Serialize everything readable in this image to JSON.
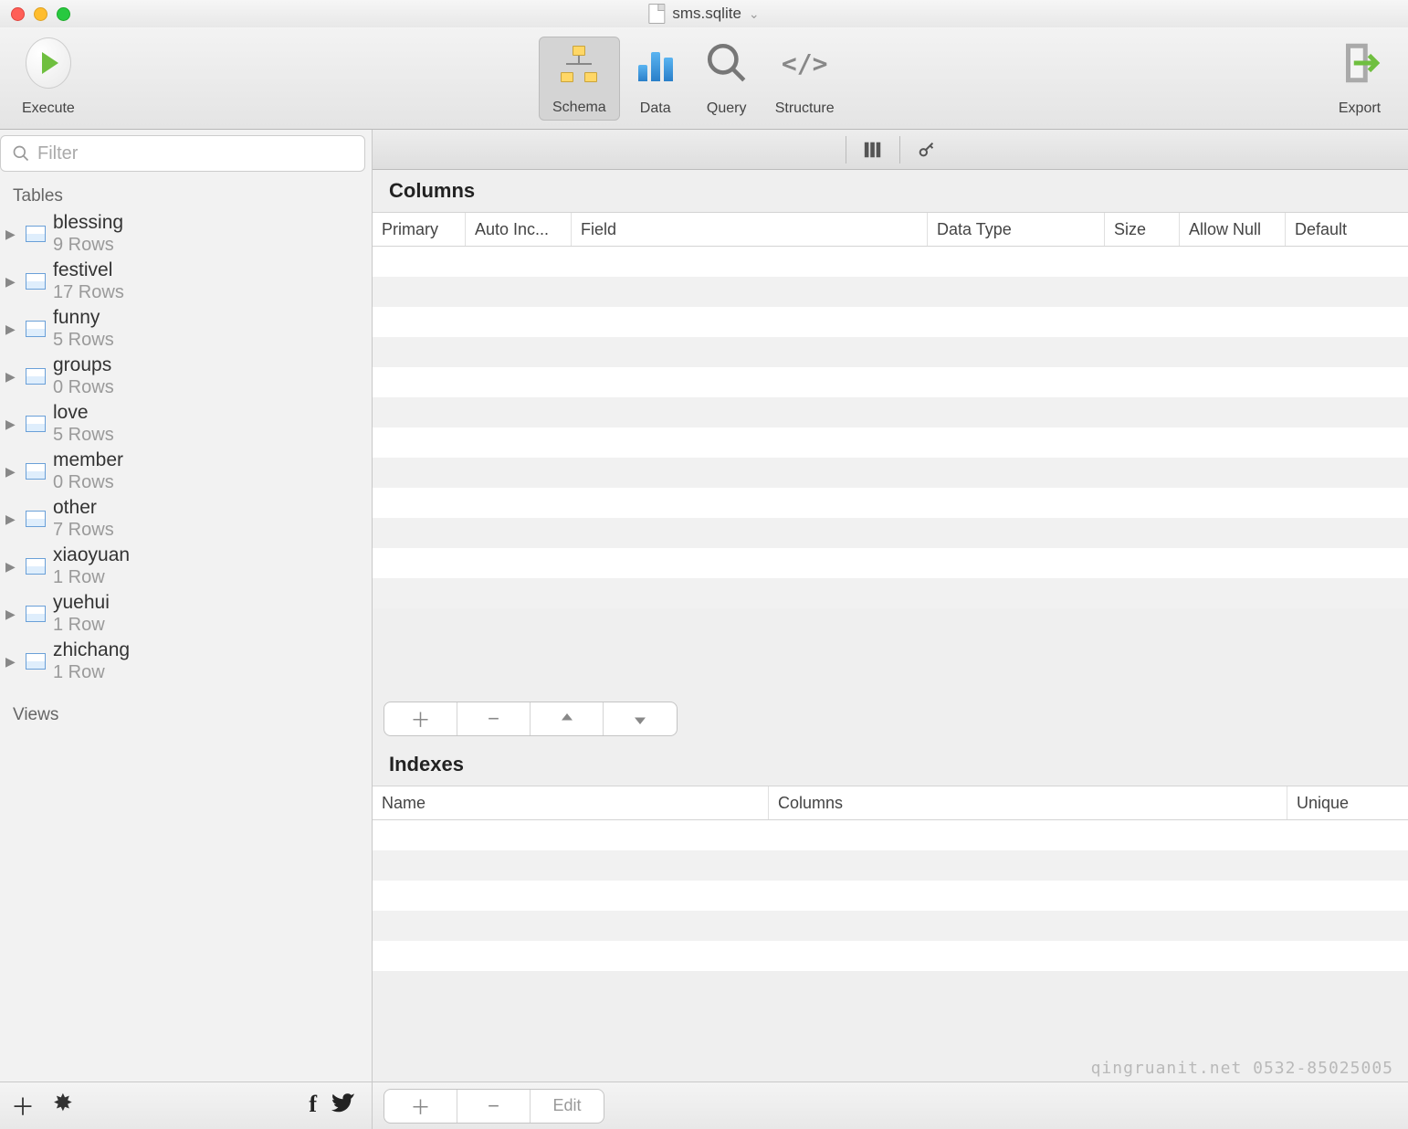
{
  "title": {
    "filename": "sms.sqlite"
  },
  "toolbar": {
    "execute": "Execute",
    "schema": "Schema",
    "data": "Data",
    "query": "Query",
    "structure": "Structure",
    "export": "Export"
  },
  "sidebar": {
    "filter_placeholder": "Filter",
    "tables_label": "Tables",
    "views_label": "Views",
    "tables": [
      {
        "name": "blessing",
        "rows": "9 Rows"
      },
      {
        "name": "festivel",
        "rows": "17 Rows"
      },
      {
        "name": "funny",
        "rows": "5 Rows"
      },
      {
        "name": "groups",
        "rows": "0 Rows"
      },
      {
        "name": "love",
        "rows": "5 Rows"
      },
      {
        "name": "member",
        "rows": "0 Rows"
      },
      {
        "name": "other",
        "rows": "7 Rows"
      },
      {
        "name": "xiaoyuan",
        "rows": "1 Row"
      },
      {
        "name": "yuehui",
        "rows": "1 Row"
      },
      {
        "name": "zhichang",
        "rows": "1 Row"
      }
    ]
  },
  "columns_section": {
    "title": "Columns",
    "headers": {
      "primary": "Primary",
      "auto": "Auto Inc...",
      "field": "Field",
      "dtype": "Data Type",
      "size": "Size",
      "allow": "Allow Null",
      "default": "Default"
    }
  },
  "indexes_section": {
    "title": "Indexes",
    "headers": {
      "name": "Name",
      "columns": "Columns",
      "unique": "Unique"
    }
  },
  "edit_label": "Edit",
  "watermark": "qingruanit.net 0532-85025005"
}
